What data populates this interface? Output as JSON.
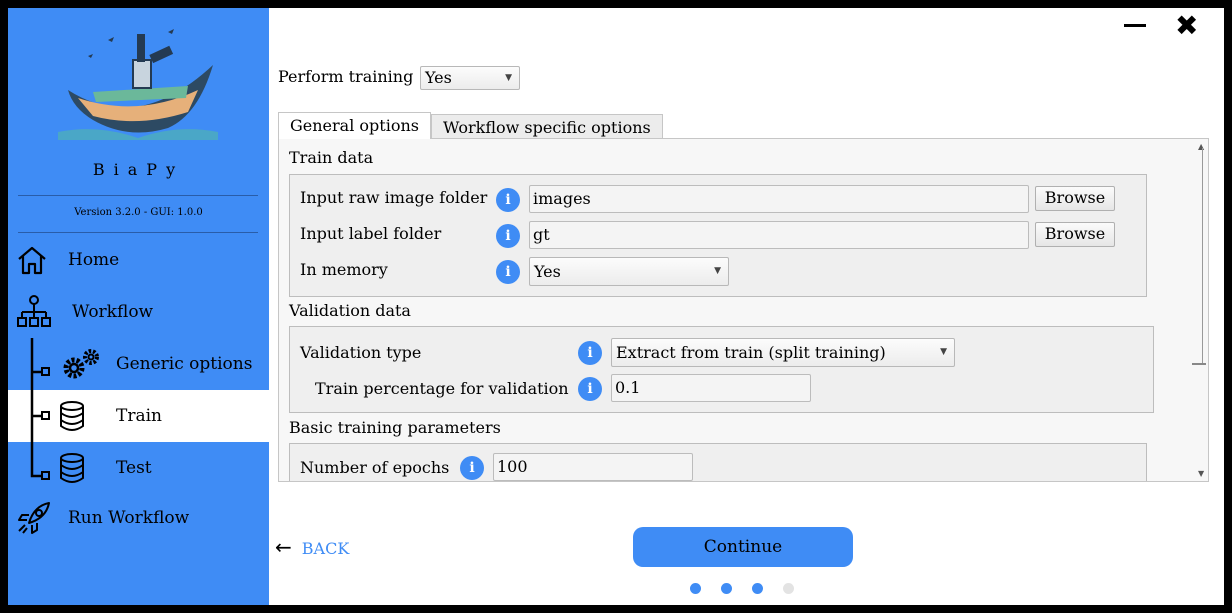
{
  "app": {
    "name": "BiaPy",
    "version": "Version 3.2.0 - GUI: 1.0.0"
  },
  "sidebar": {
    "items": [
      {
        "label": "Home",
        "icon": "home-icon"
      },
      {
        "label": "Workflow",
        "icon": "workflow-icon"
      },
      {
        "label": "Generic options",
        "icon": "gears-icon"
      },
      {
        "label": "Train",
        "icon": "database-icon",
        "active": true
      },
      {
        "label": "Test",
        "icon": "database-icon"
      },
      {
        "label": "Run Workflow",
        "icon": "rocket-icon"
      }
    ]
  },
  "window": {
    "minimize_icon": "minimize-icon",
    "close_icon": "close-icon",
    "close_glyph": "✖"
  },
  "perform_training": {
    "label": "Perform training",
    "value": "Yes"
  },
  "tabs": [
    {
      "label": "General options",
      "active": true
    },
    {
      "label": "Workflow specific options",
      "active": false
    }
  ],
  "train_data": {
    "title": "Train data",
    "raw_folder": {
      "label": "Input raw image folder",
      "value": "images",
      "button": "Browse"
    },
    "label_folder": {
      "label": "Input label folder",
      "value": "gt",
      "button": "Browse"
    },
    "in_memory": {
      "label": "In memory",
      "value": "Yes"
    }
  },
  "validation_data": {
    "title": "Validation data",
    "type": {
      "label": "Validation type",
      "value": "Extract from train (split training)"
    },
    "percentage": {
      "label": "Train percentage for validation",
      "value": "0.1"
    }
  },
  "basic_training": {
    "title": "Basic training parameters",
    "epochs": {
      "label": "Number of epochs",
      "value": "100"
    }
  },
  "info_glyph": "i",
  "footer": {
    "back_label": "BACK",
    "back_arrow": "←",
    "continue_label": "Continue",
    "steps_total": 4,
    "steps_done": 3
  },
  "colors": {
    "accent": "#3f8cf5",
    "dot_inactive": "#e3e3e3"
  }
}
